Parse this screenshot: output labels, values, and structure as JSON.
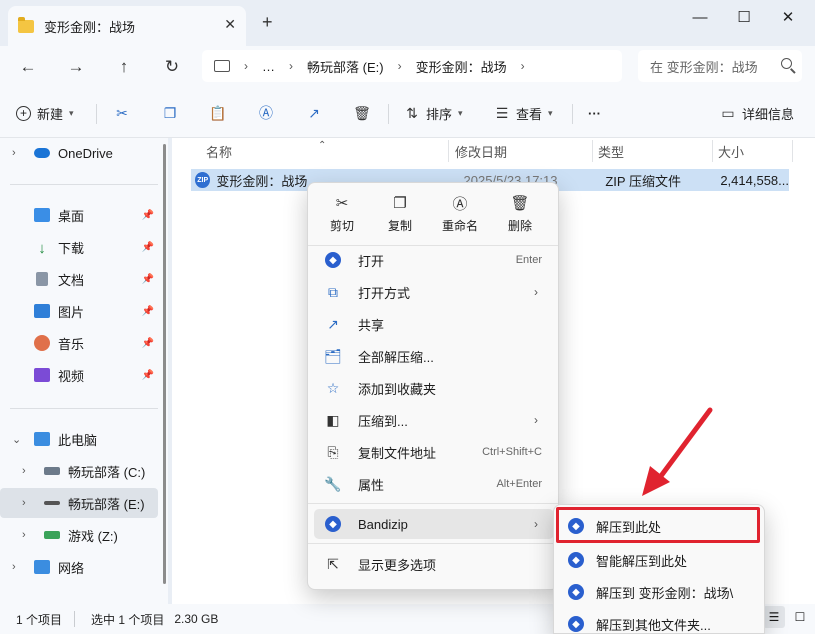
{
  "titlebar": {
    "tab_title": "变形金刚：战场",
    "close_tab": "✕",
    "new_tab": "+",
    "minimize": "—",
    "maximize": "☐",
    "close": "✕"
  },
  "addressbar": {
    "crumbs": [
      "…",
      "畅玩部落 (E:)",
      "变形金刚：战场"
    ],
    "search_placeholder": "在 变形金刚：战场"
  },
  "toolbar": {
    "new_label": "新建",
    "sort_label": "排序",
    "view_label": "查看",
    "more_label": "···",
    "details_label": "详细信息"
  },
  "sidebar": {
    "onedrive": "OneDrive",
    "quick": [
      "桌面",
      "下载",
      "文档",
      "图片",
      "音乐",
      "视频"
    ],
    "thispc": "此电脑",
    "drives": [
      "畅玩部落 (C:)",
      "畅玩部落 (E:)",
      "游戏 (Z:)"
    ],
    "network": "网络"
  },
  "columns": {
    "name": "名称",
    "modified": "修改日期",
    "type": "类型",
    "size": "大小"
  },
  "file": {
    "name": "变形金刚：战场",
    "modified": "2025/5/23 17:13",
    "type": "ZIP 压缩文件",
    "size": "2,414,558..."
  },
  "context_menu": {
    "quick": [
      "剪切",
      "复制",
      "重命名",
      "删除"
    ],
    "items": [
      {
        "label": "打开",
        "shortcut": "Enter"
      },
      {
        "label": "打开方式",
        "shortcut": ""
      },
      {
        "label": "共享",
        "shortcut": ""
      },
      {
        "label": "全部解压缩...",
        "shortcut": ""
      },
      {
        "label": "添加到收藏夹",
        "shortcut": ""
      },
      {
        "label": "压缩到...",
        "shortcut": ""
      },
      {
        "label": "复制文件地址",
        "shortcut": "Ctrl+Shift+C"
      },
      {
        "label": "属性",
        "shortcut": "Alt+Enter"
      },
      {
        "label": "Bandizip",
        "shortcut": ""
      },
      {
        "label": "显示更多选项",
        "shortcut": ""
      }
    ]
  },
  "submenu": {
    "items": [
      "解压到此处",
      "智能解压到此处",
      "解压到 变形金刚：战场\\",
      "解压到其他文件夹..."
    ]
  },
  "status": {
    "count": "1 个项目",
    "selected": "选中 1 个项目",
    "size": "2.30 GB"
  },
  "colors": {
    "accent": "#2b6cc4",
    "highlight_box": "#e0232f",
    "selection": "#cce0f5"
  }
}
